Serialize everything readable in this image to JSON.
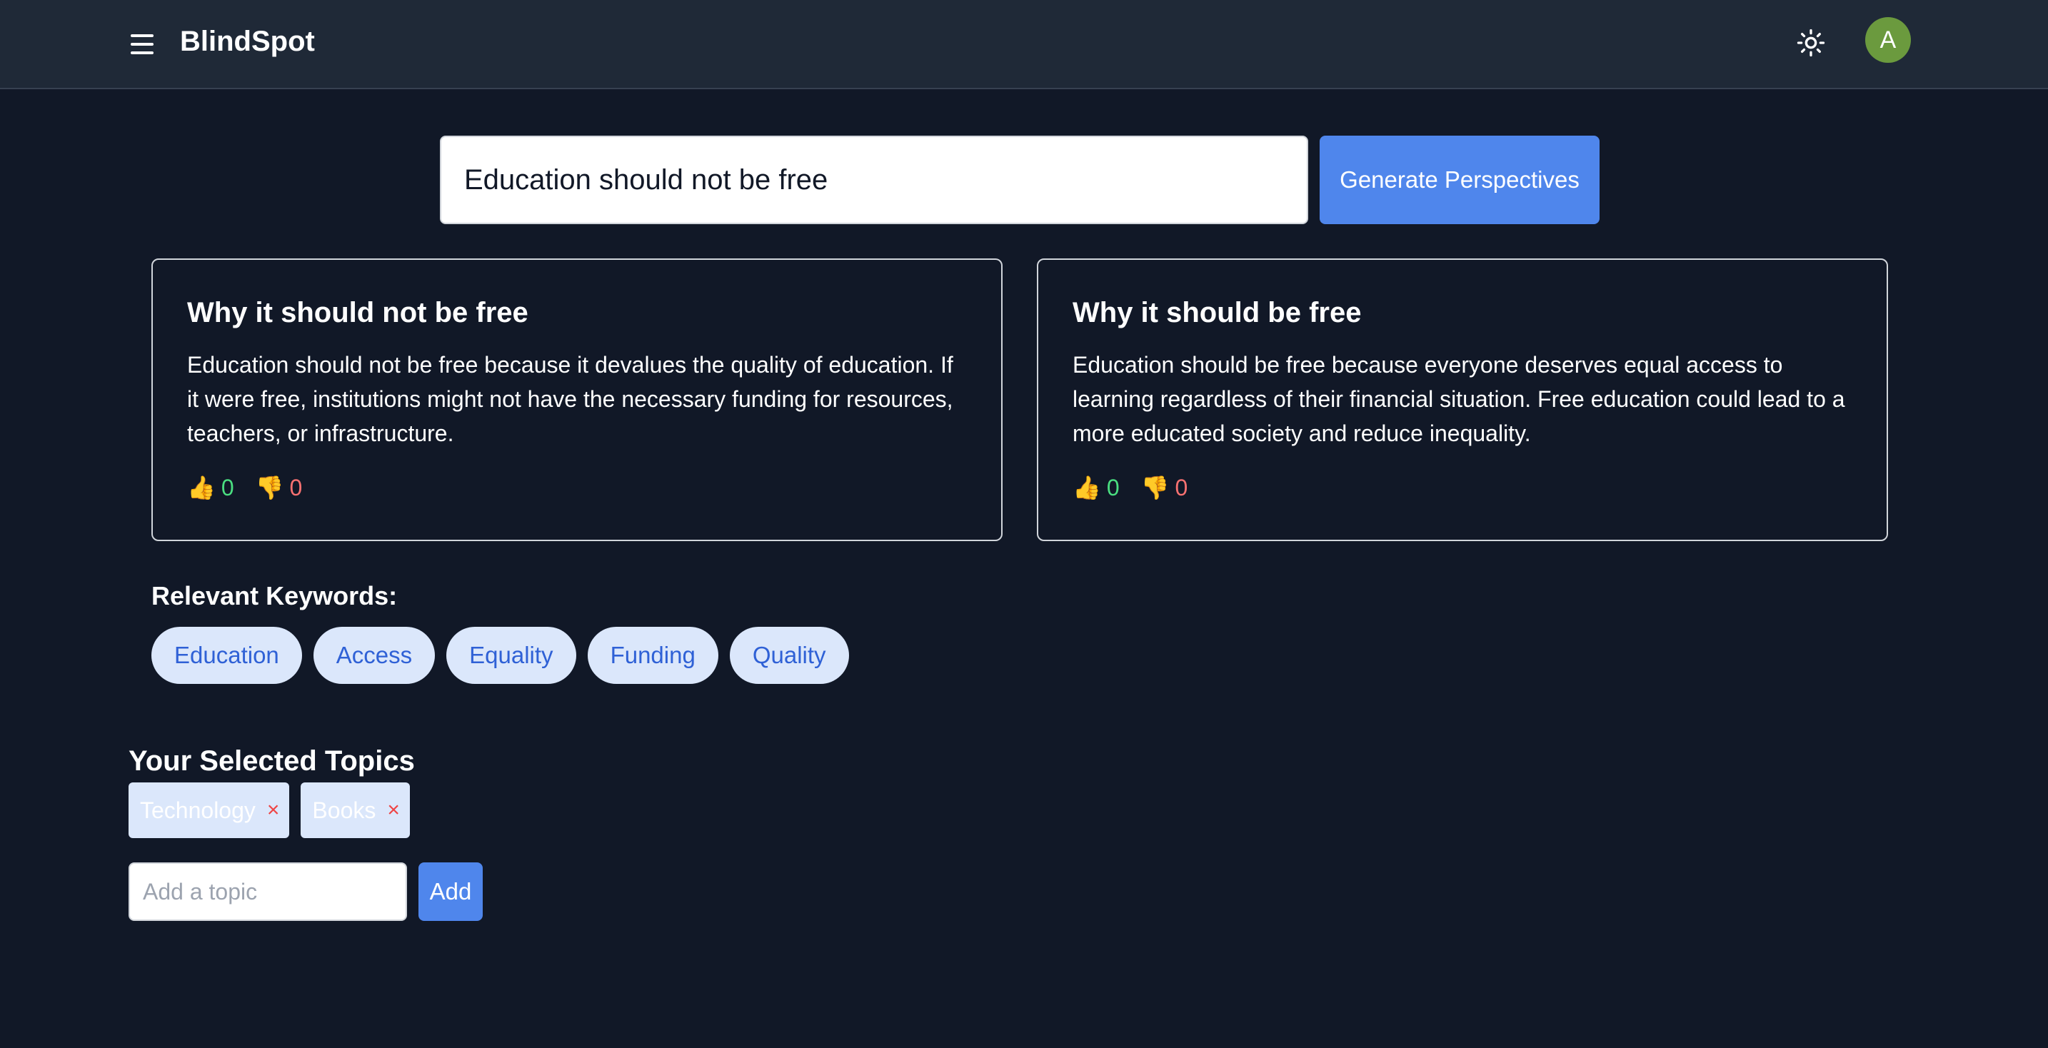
{
  "header": {
    "brand": "BlindSpot",
    "avatar_initial": "A",
    "icons": [
      "menu-icon",
      "sun-icon"
    ]
  },
  "search": {
    "value": "Education should not be free",
    "button_label": "Generate Perspectives"
  },
  "perspectives": [
    {
      "title": "Why it should not be free",
      "body": "Education should not be free because it devalues the quality of education. If it were free, institutions might not have the necessary funding for resources, teachers, or infrastructure.",
      "up_icon": "👍",
      "down_icon": "👎",
      "upvotes": "0",
      "downvotes": "0"
    },
    {
      "title": "Why it should be free",
      "body": "Education should be free because everyone deserves equal access to learning regardless of their financial situation. Free education could lead to a more educated society and reduce inequality.",
      "up_icon": "👍",
      "down_icon": "👎",
      "upvotes": "0",
      "downvotes": "0"
    }
  ],
  "keywords": {
    "title": "Relevant Keywords:",
    "items": [
      "Education",
      "Access",
      "Equality",
      "Funding",
      "Quality"
    ]
  },
  "topics": {
    "title": "Your Selected Topics",
    "items": [
      {
        "label": "Technology",
        "remove": "×"
      },
      {
        "label": "Books",
        "remove": "×"
      }
    ],
    "input_placeholder": "Add a topic",
    "add_label": "Add"
  },
  "colors": {
    "background": "#111827",
    "navbar": "#1f2937",
    "accent": "#4f86ec",
    "upvote": "#4ade80",
    "downvote": "#f87171",
    "avatar": "#6b9a3e"
  }
}
